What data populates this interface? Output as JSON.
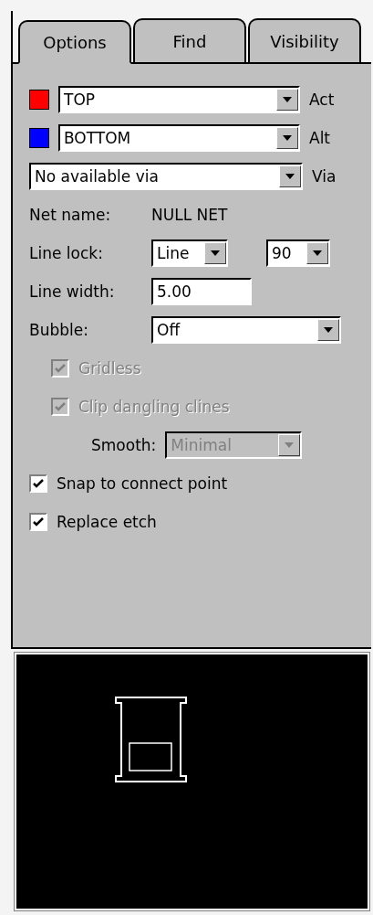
{
  "tabs": [
    {
      "label": "Options",
      "selected": true
    },
    {
      "label": "Find",
      "selected": false
    },
    {
      "label": "Visibility",
      "selected": false
    }
  ],
  "layers": [
    {
      "color": "#ff0000",
      "value": "TOP",
      "label": "Act"
    },
    {
      "color": "#0000ff",
      "value": "BOTTOM",
      "label": "Alt"
    }
  ],
  "via": {
    "value": "No available via",
    "label": "Via"
  },
  "net_name": {
    "label": "Net name:",
    "value": "NULL NET"
  },
  "line_lock": {
    "label": "Line lock:",
    "mode": "Line",
    "angle": "90"
  },
  "line_width": {
    "label": "Line width:",
    "value": "5.00"
  },
  "bubble": {
    "label": "Bubble:",
    "value": "Off"
  },
  "options": [
    {
      "kind": "checkbox",
      "label": "Gridless",
      "checked": true,
      "disabled": true
    },
    {
      "kind": "checkbox",
      "label": "Clip dangling clines",
      "checked": true,
      "disabled": true
    },
    {
      "kind": "select",
      "label": "Smooth:",
      "value": "Minimal",
      "disabled": true
    },
    {
      "kind": "checkbox",
      "label": "Snap to connect point",
      "checked": true,
      "disabled": false
    },
    {
      "kind": "checkbox",
      "label": "Replace etch",
      "checked": true,
      "disabled": false
    }
  ]
}
